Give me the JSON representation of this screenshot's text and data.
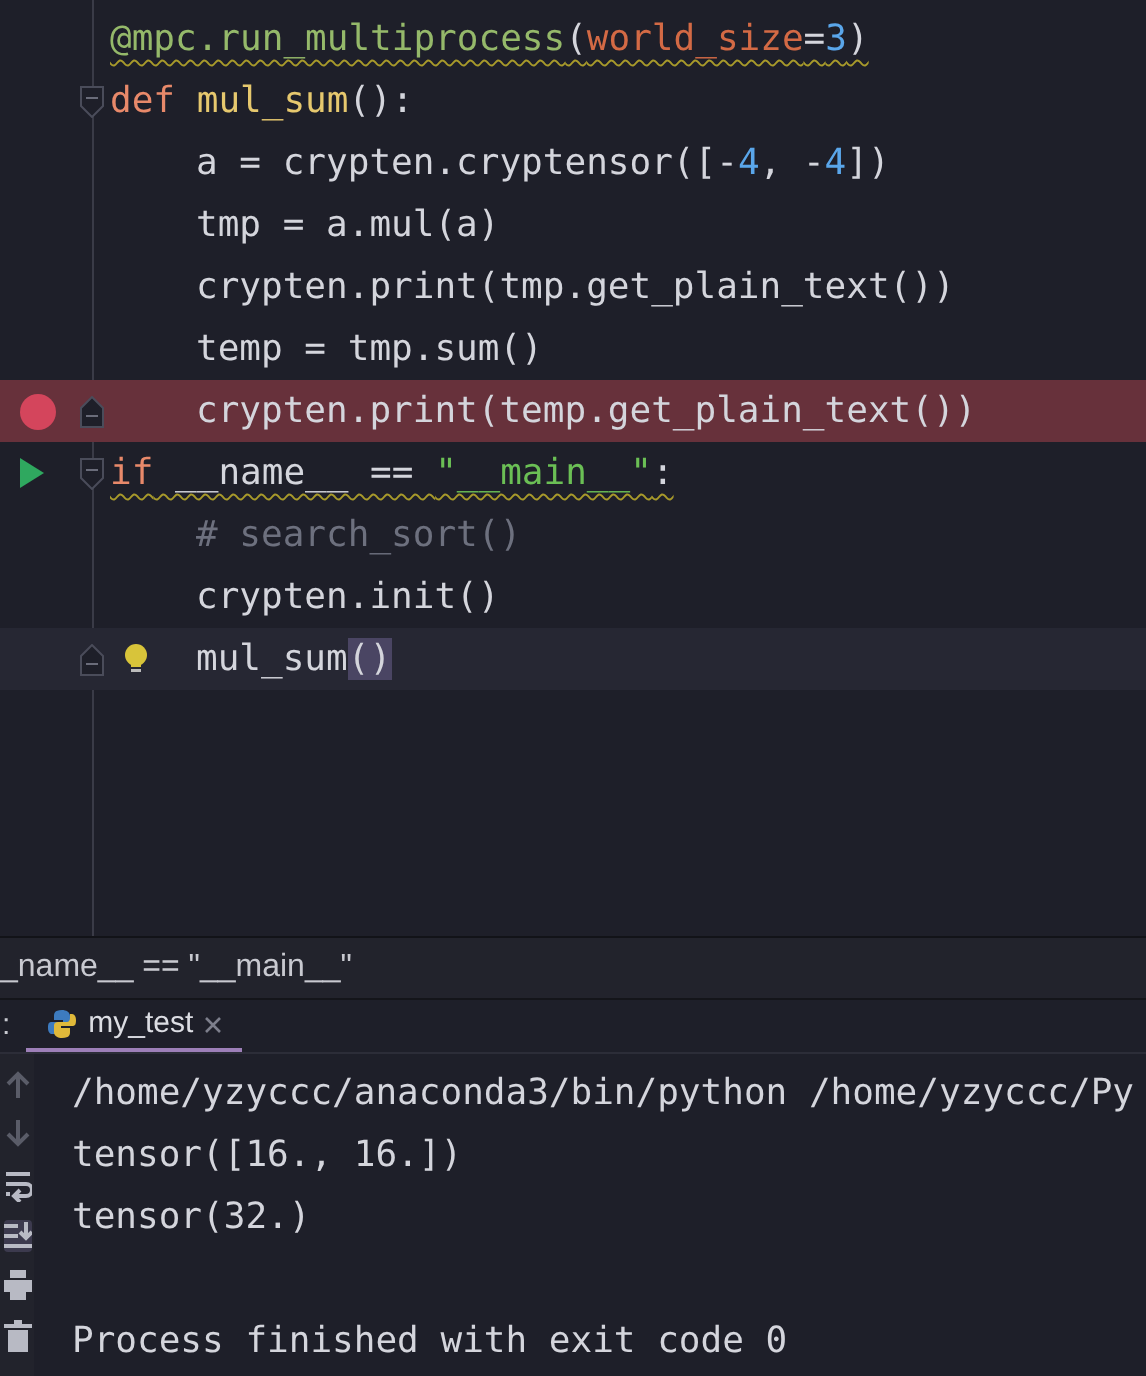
{
  "editor": {
    "lines": [
      {
        "warning": true,
        "tokens": [
          {
            "text": "@mpc.run_multiprocess",
            "kind": "decorator"
          },
          {
            "text": "(",
            "kind": "plain"
          },
          {
            "text": "world_size",
            "kind": "param"
          },
          {
            "text": "=",
            "kind": "plain"
          },
          {
            "text": "3",
            "kind": "number"
          },
          {
            "text": ")",
            "kind": "plain"
          }
        ]
      },
      {
        "fold_start": true,
        "tokens": [
          {
            "text": "def ",
            "kind": "keyword"
          },
          {
            "text": "mul_sum",
            "kind": "function"
          },
          {
            "text": "():",
            "kind": "plain"
          }
        ],
        "children": [
          {
            "tokens": [
              {
                "text": "a = crypten.cryptensor([-",
                "kind": "plain"
              },
              {
                "text": "4",
                "kind": "number"
              },
              {
                "text": ", -",
                "kind": "plain"
              },
              {
                "text": "4",
                "kind": "number"
              },
              {
                "text": "])",
                "kind": "plain"
              }
            ]
          },
          {
            "tokens": [
              {
                "text": "tmp = a.mul(a)",
                "kind": "plain"
              }
            ]
          },
          {
            "tokens": [
              {
                "text": "crypten.print(tmp.get_plain_text())",
                "kind": "plain"
              }
            ]
          },
          {
            "tokens": [
              {
                "text": "temp = tmp.sum()",
                "kind": "plain"
              }
            ]
          },
          {
            "fold_end": true,
            "breakpoint": true,
            "tokens": [
              {
                "text": "crypten.print(temp.get_plain_text())",
                "kind": "plain"
              }
            ]
          }
        ]
      },
      {
        "fold_start": true,
        "run_marker": true,
        "warning": true,
        "tokens": [
          {
            "text": "if",
            "kind": "keyword"
          },
          {
            "text": " __name__ == ",
            "kind": "plain"
          },
          {
            "text": "\"__main__\"",
            "kind": "string"
          },
          {
            "text": ":",
            "kind": "plain"
          }
        ],
        "children": [
          {
            "tokens": [
              {
                "text": "# search_sort()",
                "kind": "comment"
              }
            ]
          },
          {
            "tokens": [
              {
                "text": "crypten.init()",
                "kind": "plain"
              }
            ]
          },
          {
            "fold_end": true,
            "bulb": true,
            "current": true,
            "tokens": [
              {
                "text": "mul_sum",
                "kind": "plain"
              },
              {
                "text": "()",
                "kind": "matched"
              }
            ]
          }
        ]
      }
    ]
  },
  "breadcrumb": "_name__ == \"__main__\"",
  "run_panel": {
    "label": ":",
    "tabs": [
      {
        "label": "my_test",
        "selected": true
      }
    ],
    "tools": [
      {
        "kind": "up",
        "disabled": true
      },
      {
        "kind": "down",
        "disabled": true
      },
      {
        "kind": "wrap",
        "on": false
      },
      {
        "kind": "scroll-end",
        "on": true
      },
      {
        "kind": "print"
      },
      {
        "kind": "trash"
      }
    ],
    "output_blocks": [
      [
        "/home/yzyccc/anaconda3/bin/python /home/yzyccc/Py",
        "tensor([16., 16.])",
        "tensor(32.)"
      ],
      [
        "Process finished with exit code 0"
      ]
    ]
  }
}
